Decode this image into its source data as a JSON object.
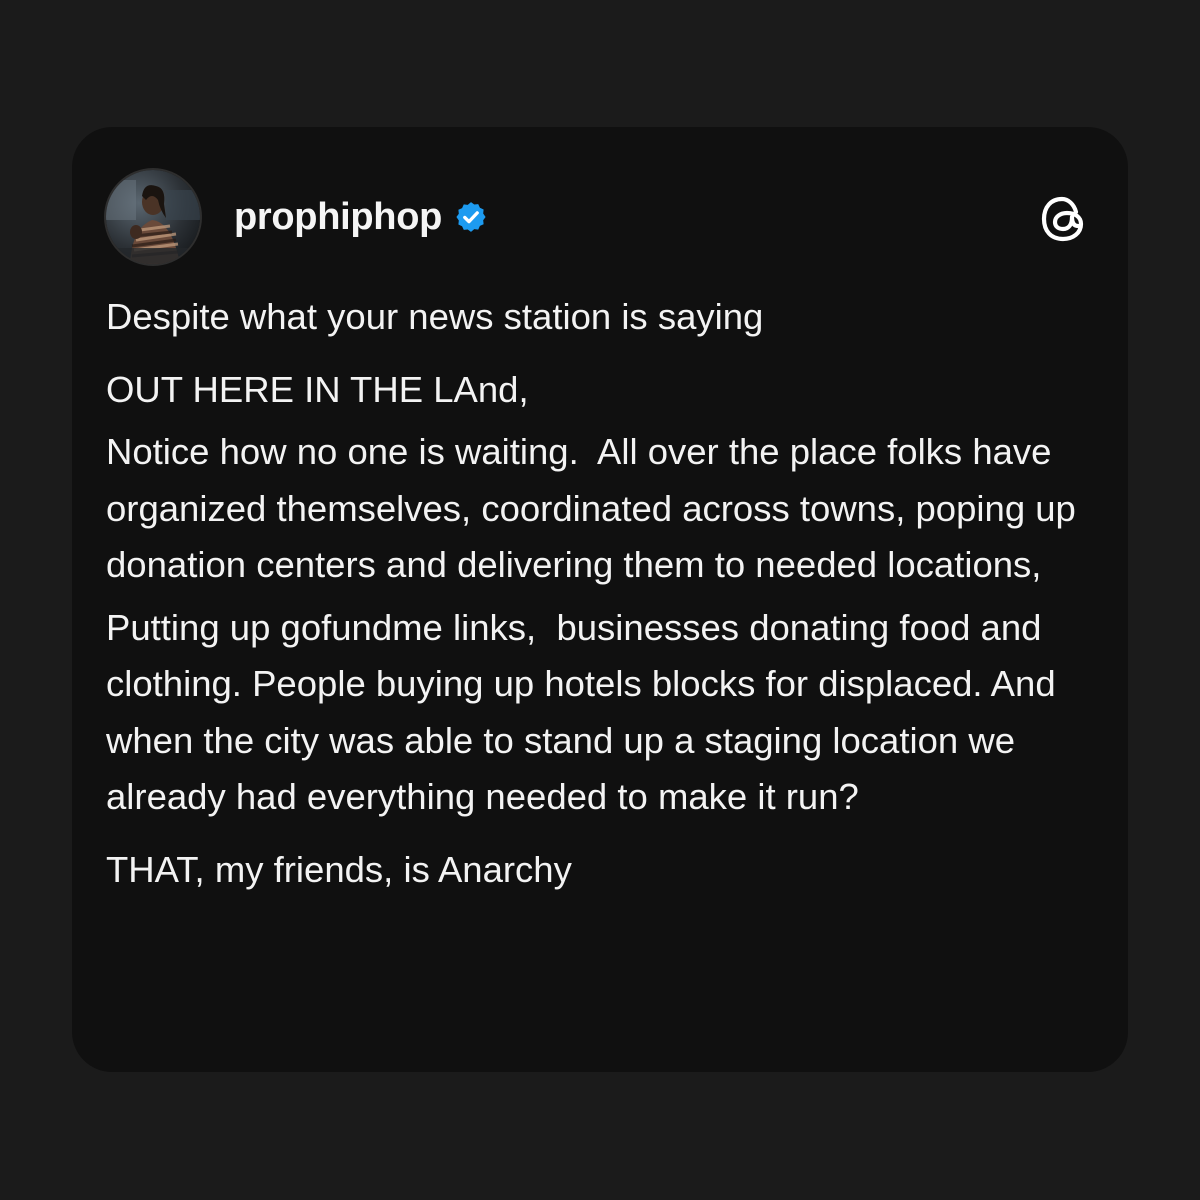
{
  "post": {
    "username": "prophiphop",
    "verified_icon": "verified-badge-icon",
    "app_icon": "threads-logo-icon",
    "avatar_icon": "profile-photo",
    "colors": {
      "page_background": "#1b1b1b",
      "card_background": "#101010",
      "text": "#f3f3f3",
      "verified_badge": "#1d9bf0"
    },
    "paragraphs": [
      "Despite what your news station is saying",
      "OUT HERE IN THE LAnd,",
      "Notice how no one is waiting.  All over the place folks have organized themselves, coordinated across towns, poping up donation centers and delivering them to needed locations,",
      "Putting up gofundme links,  businesses donating food and clothing. People buying up hotels blocks for displaced. And when the city was able to stand up a staging location we already had everything needed to make it run?",
      "THAT, my friends, is Anarchy"
    ]
  }
}
